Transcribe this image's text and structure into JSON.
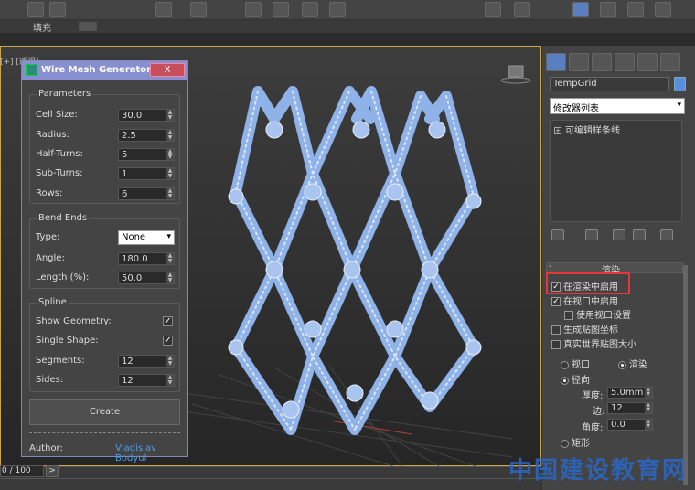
{
  "toolbar": {
    "ribbon_fill_label": "填充"
  },
  "viewport": {
    "label": "[+] [透视]"
  },
  "dialog": {
    "title": "Wire Mesh Generator",
    "close_label": "X",
    "parameters": {
      "title": "Parameters",
      "cell_size": {
        "label": "Cell Size:",
        "value": "30.0"
      },
      "radius": {
        "label": "Radius:",
        "value": "2.5"
      },
      "half_turns": {
        "label": "Half-Turns:",
        "value": "5"
      },
      "sub_turns": {
        "label": "Sub-Turns:",
        "value": "1"
      },
      "rows": {
        "label": "Rows:",
        "value": "6"
      }
    },
    "bend_ends": {
      "title": "Bend Ends",
      "type": {
        "label": "Type:",
        "value": "None"
      },
      "angle": {
        "label": "Angle:",
        "value": "180.0"
      },
      "length": {
        "label": "Length (%):",
        "value": "50.0"
      }
    },
    "spline": {
      "title": "Spline",
      "show_geometry": {
        "label": "Show Geometry:",
        "checked": true
      },
      "single_shape": {
        "label": "Single Shape:",
        "checked": true
      },
      "segments": {
        "label": "Segments:",
        "value": "12"
      },
      "sides": {
        "label": "Sides:",
        "value": "12"
      }
    },
    "create_label": "Create",
    "author_label": "Author:",
    "author_value": "Vladislav Bodyul"
  },
  "command_panel": {
    "object_name": "TempGrid",
    "object_color": "#5a8fe0",
    "modifier_list": "修改器列表",
    "stack_item": "可编辑样条线",
    "rollout_title": "渲染",
    "enable_in_renderer": "在渲染中启用",
    "enable_in_viewport": "在视口中启用",
    "use_viewport_settings": "使用视口设置",
    "generate_mapping": "生成贴图坐标",
    "real_world_map": "真实世界贴图大小",
    "viewport_radio": "视口",
    "render_radio": "渲染",
    "radial_radio": "径向",
    "thickness_label": "厚度:",
    "thickness_value": "5.0mm",
    "sides_label": "边:",
    "sides_value": "12",
    "angle_label": "角度:",
    "angle_value": "0.0",
    "rectangular_radio": "矩形"
  },
  "timeline": {
    "frame": "0 / 100",
    "next_label": ">"
  },
  "watermark": "中国建设教育网",
  "colors": {
    "accent": "#c9a646",
    "mesh": "#8fb3e8",
    "highlight": "#e8353a",
    "dialog_title": "#888fd0"
  }
}
